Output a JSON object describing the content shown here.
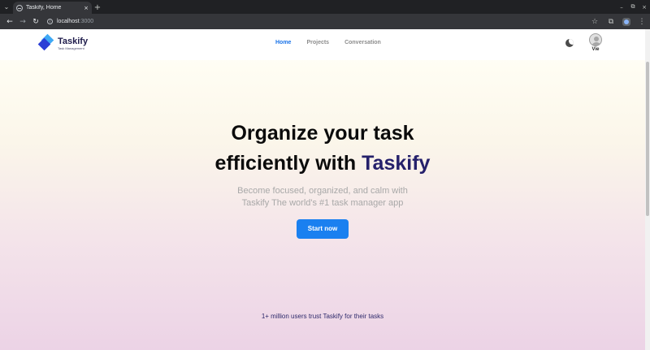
{
  "browser": {
    "tab_title": "Taskify, Home",
    "tab_close": "×",
    "new_tab": "+",
    "url_host": "localhost",
    "url_port": ":3000",
    "window_controls": [
      "–",
      "⧉",
      "×"
    ]
  },
  "nav": {
    "logo_name": "Taskify",
    "logo_tagline": "Task Management",
    "links": [
      {
        "label": "Home",
        "active": true
      },
      {
        "label": "Projects",
        "active": false
      },
      {
        "label": "Conversation",
        "active": false
      }
    ],
    "user_name": "Vie"
  },
  "hero": {
    "title_line1": "Organize your task",
    "title_line2_prefix": "efficiently with ",
    "title_brand": "Taskify",
    "subtitle_line1": "Become focused, organized, and calm with",
    "subtitle_line2": "Taskify The world's #1 task manager app",
    "cta_label": "Start now"
  },
  "trust_text": "1+ million users trust Taskify for their tasks",
  "colors": {
    "accent": "#1a80f0",
    "brand_dark": "#25206b",
    "active_link": "#1a73e8"
  },
  "icons": {
    "theme_toggle": "moon-icon",
    "user": "avatar-icon"
  }
}
